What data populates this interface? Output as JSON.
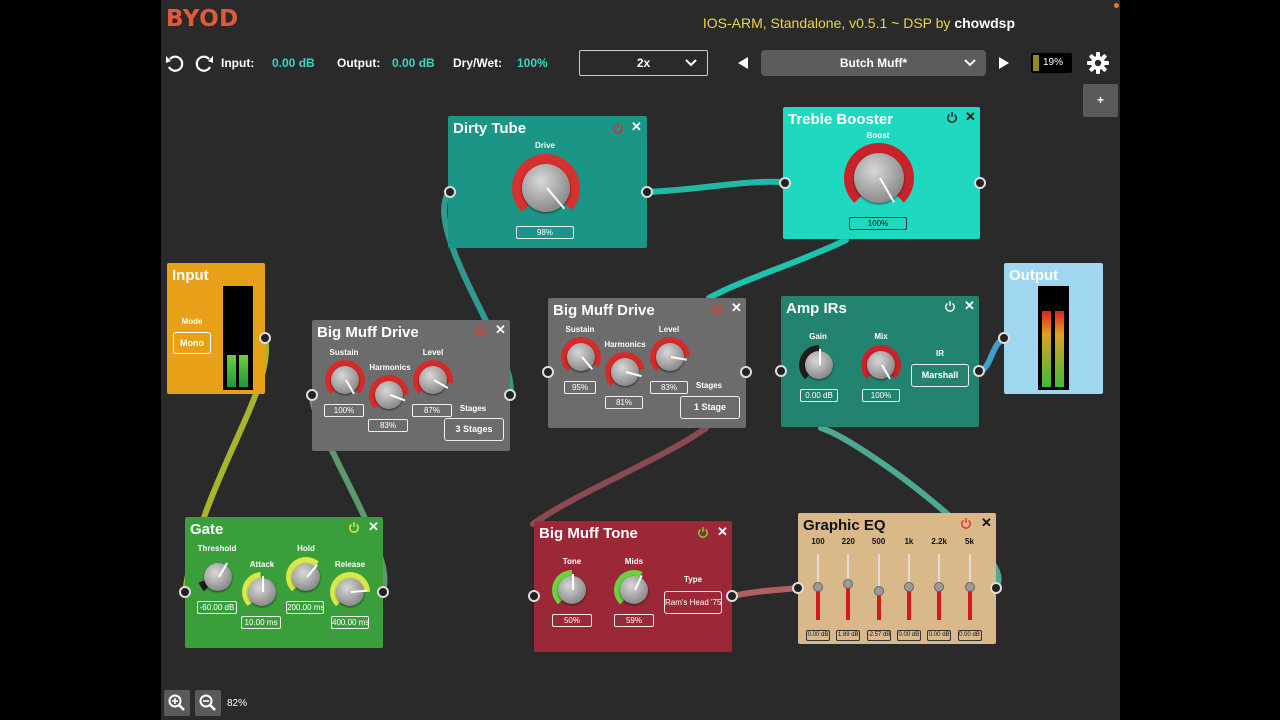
{
  "app": {
    "logo": "BYOD",
    "meta_prefix": "IOS-ARM, Standalone, v0.5.1 ~ DSP by ",
    "meta_brand": "chowdsp"
  },
  "toolbar": {
    "input_label": "Input:",
    "input_value": "0.00 dB",
    "output_label": "Output:",
    "output_value": "0.00 dB",
    "drywet_label": "Dry/Wet:",
    "drywet_value": "100%",
    "oversampling": "2x",
    "preset_name": "Butch Muff*",
    "cpu": "19%",
    "add_label": "+"
  },
  "zoom": {
    "value": "82%"
  },
  "colors": {
    "background": "#2a2a2a",
    "dirty_tube": "#1b9585",
    "treble_booster": "#1fd8c0",
    "input": "#e8a018",
    "output": "#9fd6f0",
    "big_muff_drive": "#6c6c6c",
    "amp_irs": "#228470",
    "gate": "#3a9f3a",
    "big_muff_tone": "#9c2737",
    "graphic_eq": "#d9b98a"
  },
  "processors": {
    "dirty_tube": {
      "name": "Dirty Tube",
      "drive_label": "Drive",
      "drive_value": "98%"
    },
    "treble_booster": {
      "name": "Treble Booster",
      "boost_label": "Boost",
      "boost_value": "100%"
    },
    "input": {
      "name": "Input",
      "mode_label": "Mode",
      "mode_value": "Mono"
    },
    "output": {
      "name": "Output"
    },
    "big_muff_drive_1": {
      "name": "Big Muff Drive",
      "sustain_label": "Sustain",
      "sustain_value": "100%",
      "harmonics_label": "Harmonics",
      "harmonics_value": "83%",
      "level_label": "Level",
      "level_value": "87%",
      "stages_label": "Stages",
      "stages_value": "3 Stages"
    },
    "big_muff_drive_2": {
      "name": "Big Muff Drive",
      "sustain_label": "Sustain",
      "sustain_value": "95%",
      "harmonics_label": "Harmonics",
      "harmonics_value": "81%",
      "level_label": "Level",
      "level_value": "83%",
      "stages_label": "Stages",
      "stages_value": "1 Stage"
    },
    "amp_irs": {
      "name": "Amp IRs",
      "gain_label": "Gain",
      "gain_value": "0.00 dB",
      "mix_label": "Mix",
      "mix_value": "100%",
      "ir_label": "IR",
      "ir_value": "Marshall"
    },
    "gate": {
      "name": "Gate",
      "threshold_label": "Threshold",
      "threshold_value": "-60.00 dB",
      "attack_label": "Attack",
      "attack_value": "10.00 ms",
      "hold_label": "Hold",
      "hold_value": "200.00 ms",
      "release_label": "Release",
      "release_value": "400.00 ms"
    },
    "big_muff_tone": {
      "name": "Big Muff Tone",
      "tone_label": "Tone",
      "tone_value": "50%",
      "mids_label": "Mids",
      "mids_value": "59%",
      "type_label": "Type",
      "type_value": "Ram's Head '75"
    },
    "graphic_eq": {
      "name": "Graphic EQ",
      "bands": [
        {
          "freq": "100",
          "gain": "0.00 dB",
          "level": 0.5
        },
        {
          "freq": "220",
          "gain": "1.89 dB",
          "level": 0.56
        },
        {
          "freq": "500",
          "gain": "-2.57 dB",
          "level": 0.42
        },
        {
          "freq": "1k",
          "gain": "0.00 dB",
          "level": 0.5
        },
        {
          "freq": "2.2k",
          "gain": "0.00 dB",
          "level": 0.5
        },
        {
          "freq": "5k",
          "gain": "0.00 dB",
          "level": 0.5
        }
      ]
    }
  }
}
